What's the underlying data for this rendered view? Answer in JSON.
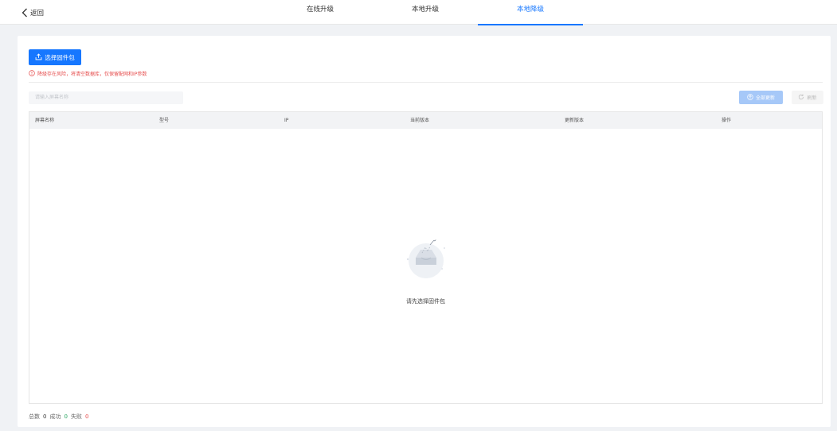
{
  "header": {
    "back_label": "返回",
    "tabs": [
      {
        "label": "在线升级",
        "active": false
      },
      {
        "label": "本地升级",
        "active": false
      },
      {
        "label": "本地降级",
        "active": true
      }
    ]
  },
  "toolbar": {
    "select_firmware_label": "选择固件包",
    "warning_text": "降级存在风险，将清空数据库，仅保留配网和IP参数",
    "search_placeholder": "请输入屏幕名称",
    "update_all_label": "全部更新",
    "refresh_label": "刷新"
  },
  "table": {
    "columns": [
      "屏幕名称",
      "型号",
      "IP",
      "当前版本",
      "更新版本",
      "操作"
    ],
    "rows": [],
    "empty_text": "请先选择固件包"
  },
  "footer": {
    "total_label": "总数",
    "total_value": "0",
    "success_label": "成功",
    "success_value": "0",
    "fail_label": "失败",
    "fail_value": "0"
  },
  "colors": {
    "accent": "#1677ff",
    "warning": "#e54b4b",
    "success": "#25a55e",
    "disabled_accent": "#a6c8f8"
  },
  "icons": {
    "back": "chevron-left-icon",
    "upload": "upload-icon",
    "warning": "warning-circle-icon",
    "update_all": "arrow-up-circle-icon",
    "refresh": "refresh-icon",
    "empty": "empty-box-icon"
  }
}
